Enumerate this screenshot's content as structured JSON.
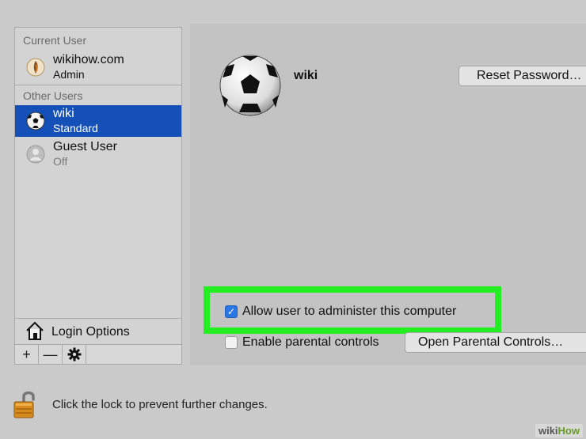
{
  "sidebar": {
    "current_user_label": "Current User",
    "other_users_label": "Other Users",
    "current_user": {
      "name": "wikihow.com",
      "role": "Admin"
    },
    "users": [
      {
        "name": "wiki",
        "role": "Standard",
        "selected": true
      },
      {
        "name": "Guest User",
        "role": "Off",
        "selected": false
      }
    ],
    "login_options_label": "Login Options",
    "toolbar": {
      "add": "+",
      "remove": "—",
      "settings_icon": "gear-icon"
    }
  },
  "detail": {
    "user_name": "wiki",
    "reset_password_label": "Reset Password…",
    "allow_admin_label": "Allow user to administer this computer",
    "allow_admin_checked": true,
    "parental_controls_label": "Enable parental controls",
    "parental_controls_checked": false,
    "open_parental_label": "Open Parental Controls…"
  },
  "footer": {
    "lock_text": "Click the lock to prevent further changes."
  },
  "watermark": {
    "part1": "wiki",
    "part2": "How"
  },
  "colors": {
    "selection": "#1550b9",
    "highlight": "#22ee22",
    "checkbox_checked": "#2b78e4"
  }
}
